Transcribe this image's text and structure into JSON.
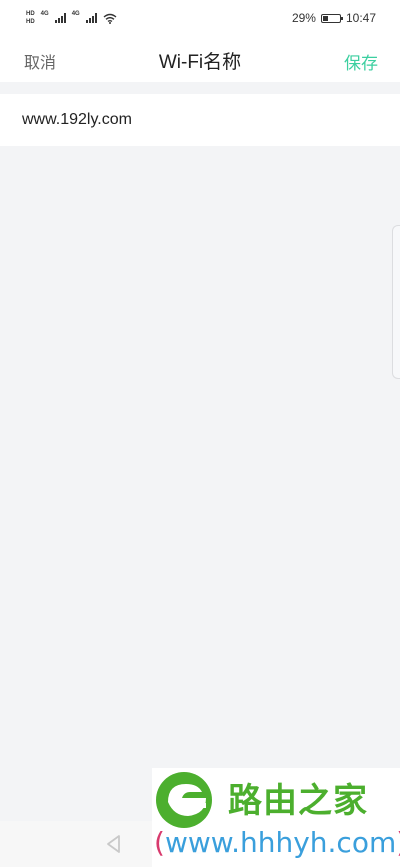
{
  "status_bar": {
    "hd_label": "HD",
    "network_type_1": "4G",
    "network_type_2": "4G",
    "battery_percent": "29%",
    "battery_level": 0.29,
    "time": "10:47"
  },
  "header": {
    "cancel_label": "取消",
    "title": "Wi-Fi名称",
    "save_label": "保存",
    "save_color": "#3ccfa0"
  },
  "wifi_name_field": {
    "value": "www.192ly.com"
  },
  "watermark": {
    "brand": "路由之家",
    "url_open": "(",
    "url": "www.hhhyh.com",
    "url_close": ")"
  }
}
